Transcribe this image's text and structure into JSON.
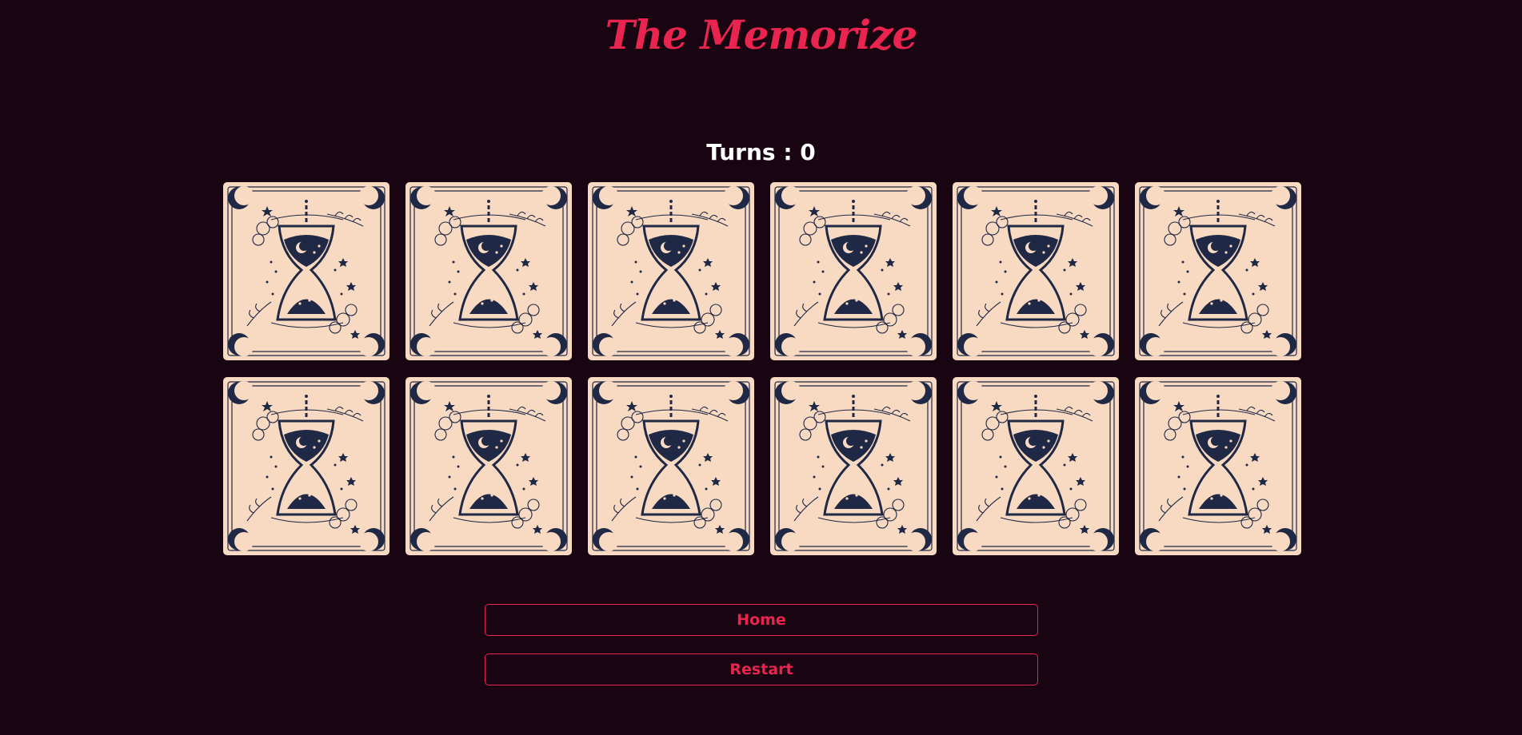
{
  "header": {
    "logo": "The Memorize"
  },
  "game": {
    "turns_label": "Turns : 0",
    "card_count": 12,
    "card_back_icon": "hourglass-tarot-icon"
  },
  "buttons": {
    "home": "Home",
    "restart": "Restart"
  },
  "colors": {
    "background": "#190411",
    "accent": "#e8244f",
    "card_back": "#f8d9c2",
    "card_ink": "#1f2844"
  }
}
